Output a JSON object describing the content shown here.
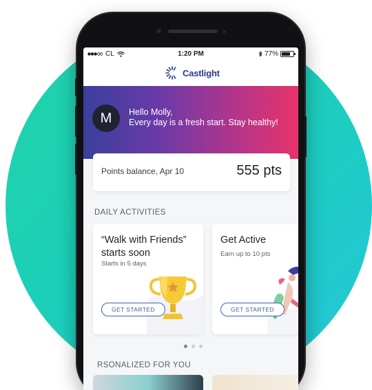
{
  "status_bar": {
    "carrier": "CL",
    "time": "1:20 PM",
    "battery": "77%",
    "battery_level": 0.77
  },
  "app": {
    "brand": "Castlight",
    "colors": {
      "brand": "#2a3a8c",
      "accent": "#3c5fb6",
      "hero_start": "#3b3f9c",
      "hero_end": "#e8336a",
      "background_circle": "#1fd4a8"
    }
  },
  "hero": {
    "avatar_initial": "M",
    "greeting": "Hello Molly,",
    "message": "Every day is a fresh start. Stay healthy!"
  },
  "points": {
    "label": "Points balance, Apr 10",
    "value": "555 pts"
  },
  "daily": {
    "title": "DAILY ACTIVITIES",
    "cards": [
      {
        "title_line1": "“Walk with Friends”",
        "title_line2": "starts soon",
        "subtitle": "Starts in 5 days",
        "button": "GET STARTED",
        "art": "trophy-icon"
      },
      {
        "title_line1": "Get Active",
        "subtitle": "Earn up to 10 pts",
        "button": "GET STARTED",
        "art": "runner-illustration"
      }
    ],
    "pager": {
      "count": 3,
      "active": 0
    }
  },
  "personalized": {
    "title": "PERSONALIZED FOR YOU",
    "title_visible": "RSONALIZED FOR YOU"
  }
}
